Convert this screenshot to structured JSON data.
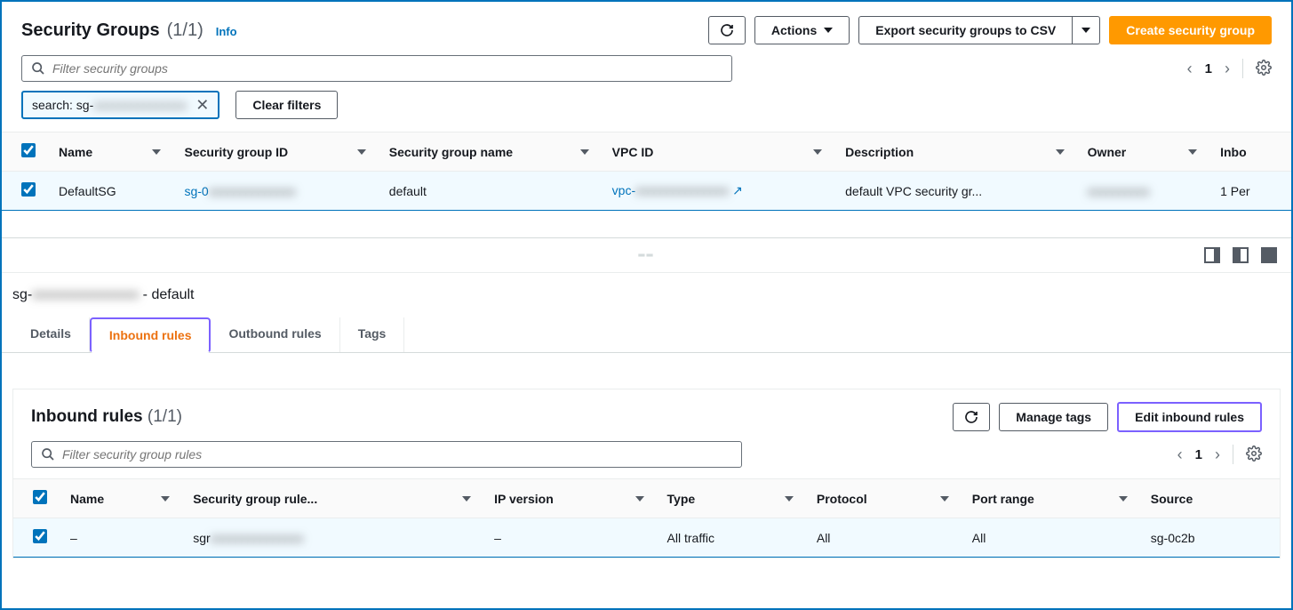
{
  "header": {
    "title": "Security Groups",
    "count": "(1/1)",
    "info": "Info",
    "actions_label": "Actions",
    "export_label": "Export security groups to CSV",
    "create_label": "Create security group"
  },
  "filter": {
    "placeholder": "Filter security groups",
    "chip_prefix": "search: sg-",
    "chip_blur": "xxxxxxxxxxxxxxx",
    "clear_label": "Clear filters",
    "page_num": "1"
  },
  "table": {
    "cols": {
      "name": "Name",
      "sgid": "Security group ID",
      "sgname": "Security group name",
      "vpc": "VPC ID",
      "desc": "Description",
      "owner": "Owner",
      "inbound": "Inbo"
    },
    "row": {
      "name": "DefaultSG",
      "sgid_prefix": "sg-0",
      "sgid_blur": "xxxxxxxxxxxxxx",
      "sgname": "default",
      "vpc_prefix": "vpc-",
      "vpc_blur": "xxxxxxxxxxxxxxx",
      "desc": "default VPC security gr...",
      "owner_blur": "xxxxxxxxxx",
      "inbound": "1 Per"
    }
  },
  "detail": {
    "title_prefix": "sg-",
    "title_blur": "xxxxxxxxxxxxxxx",
    "title_suffix": " - default",
    "tabs": {
      "details": "Details",
      "inbound": "Inbound rules",
      "outbound": "Outbound rules",
      "tags": "Tags"
    }
  },
  "inbound_panel": {
    "title": "Inbound rules",
    "count": "(1/1)",
    "manage_tags": "Manage tags",
    "edit_rules": "Edit inbound rules",
    "filter_placeholder": "Filter security group rules",
    "page_num": "1",
    "cols": {
      "name": "Name",
      "rule_id": "Security group rule...",
      "ipver": "IP version",
      "type": "Type",
      "protocol": "Protocol",
      "port": "Port range",
      "source": "Source"
    },
    "row": {
      "name": "–",
      "rule_prefix": "sgr",
      "rule_blur": "xxxxxxxxxxxxxxx",
      "ipver": "–",
      "type": "All traffic",
      "protocol": "All",
      "port": "All",
      "source": "sg-0c2b"
    }
  }
}
